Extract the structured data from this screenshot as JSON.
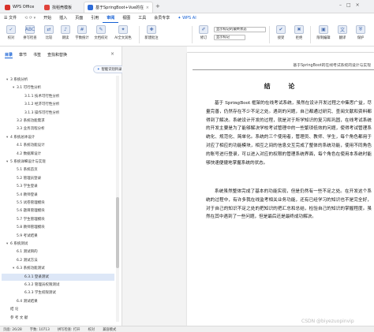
{
  "tabs": [
    {
      "label": "WPS Office",
      "color": "#d8322a"
    },
    {
      "label": "找稻壳模板",
      "color": "#e0433b"
    },
    {
      "label": "基于SpringBoot+Vue的在线考试系统",
      "color": "#2d6bd8"
    }
  ],
  "menubar": {
    "file": "☰ 文件",
    "items": [
      "开始",
      "插入",
      "页面",
      "引用",
      "审阅",
      "视图",
      "工具",
      "会员专享"
    ],
    "active": "审阅",
    "ai": "WPS AI"
  },
  "ribbon": {
    "buttons": [
      "校对",
      "拼写检查",
      "比较",
      "朗读",
      "字数统计",
      "文档校对",
      "AI全文润色",
      "新建批注"
    ],
    "right_buttons": [
      "修订",
      "显示标记",
      "审阅",
      "接受",
      "拒绝",
      "限制编辑",
      "翻译",
      "保护"
    ],
    "markup_select": "显示标记的最终状态",
    "markup_select2": "显示标记"
  },
  "nav": {
    "tabs": [
      "目录",
      "章节",
      "书签",
      "查找和替换"
    ],
    "ai_button": "智能识别目录",
    "items": [
      {
        "label": "3 系统分析",
        "level": 1,
        "caret": "▾"
      },
      {
        "label": "3.1 可行性分析",
        "level": 2,
        "caret": "▾"
      },
      {
        "label": "3.1.1 技术可行性分析",
        "level": 3,
        "caret": ""
      },
      {
        "label": "3.1.2 经济可行性分析",
        "level": 3,
        "caret": ""
      },
      {
        "label": "3.1.3 操作可行性分析",
        "level": 3,
        "caret": ""
      },
      {
        "label": "3.2 系统功能需求",
        "level": 2,
        "caret": ""
      },
      {
        "label": "3.3 业务流程分析",
        "level": 2,
        "caret": ""
      },
      {
        "label": "4 系统总体设计",
        "level": 1,
        "caret": "▾"
      },
      {
        "label": "4.1 系统功能设计",
        "level": 2,
        "caret": ""
      },
      {
        "label": "4.2 数据库设计",
        "level": 2,
        "caret": ""
      },
      {
        "label": "5 系统详细设计与实现",
        "level": 1,
        "caret": "▾"
      },
      {
        "label": "5.1 系统首页",
        "level": 2,
        "caret": ""
      },
      {
        "label": "5.2 管理员登录",
        "level": 2,
        "caret": ""
      },
      {
        "label": "5.3 学生登录",
        "level": 2,
        "caret": ""
      },
      {
        "label": "5.4 教师登录",
        "level": 2,
        "caret": ""
      },
      {
        "label": "5.5 试卷管理模块",
        "level": 2,
        "caret": ""
      },
      {
        "label": "5.6 题目管理模块",
        "level": 2,
        "caret": ""
      },
      {
        "label": "5.7 学生管理模块",
        "level": 2,
        "caret": ""
      },
      {
        "label": "5.8 教师管理模块",
        "level": 2,
        "caret": ""
      },
      {
        "label": "5.9 考试结果",
        "level": 2,
        "caret": ""
      },
      {
        "label": "6 系统测试",
        "level": 1,
        "caret": "▾"
      },
      {
        "label": "6.1 测试目的",
        "level": 2,
        "caret": ""
      },
      {
        "label": "6.2 测试方法",
        "level": 2,
        "caret": ""
      },
      {
        "label": "6.3 系统功能测试",
        "level": 2,
        "caret": "▾"
      },
      {
        "label": "6.3.1 登录测试",
        "level": 3,
        "caret": "",
        "selected": true
      },
      {
        "label": "6.3.2 管理员权限测试",
        "level": 3,
        "caret": ""
      },
      {
        "label": "6.3.3 学生权限测试",
        "level": 3,
        "caret": ""
      },
      {
        "label": "6.4 测试结果",
        "level": 2,
        "caret": ""
      },
      {
        "label": "结 论",
        "level": 1,
        "caret": ""
      },
      {
        "label": "参 考 文 献",
        "level": 1,
        "caret": ""
      }
    ]
  },
  "document": {
    "header": "基于SpringBoot的在线考试系统的设计与实现",
    "title": "结 论",
    "paragraphs": [
      "基于 SpringBoot 框架的在线考试系统，虽然在设计开发过程之中集思广益，尽量完善，仍然存在不少不足之处。遇到的问题，自己都通过研究、查阅文献和资料都得到了解决。系统设计开发的过程，就是对于所学知识的复习和巩固，在线考试系统的开发主要是为了能够解决学校考试管理中的一些繁琐低效的问题，使得考试管理系统化、规范化、简单化。系统的三个使用者，管理员、教师、学生，每个角色都用于对应了相应的功能模块，相互之间的信息交互完成了整体的系统功能，使用不同角色的账号进行登录，可以进入对应的权限的管理系统界面，每个角色在使用本系统时能够快速便捷地掌握系统的状态。",
      "系统虽然整体完成了基本的功能实现，但是仍然有一些不足之处。在开发这个系统的过程中，有许多我在线监考相关业务功能，还有已经学习的知识也不是完全好，对于自己的知识不足之处的把知识的把汇总和总结，检验自己的知识的掌握程度。虽然在其中遇到了一些问题，但是最后还是最终成功解决。"
    ]
  },
  "status": {
    "page": "页面: 26/28",
    "words": "字数: 10713",
    "spell": "拼写检查: 打开",
    "proof": "校对",
    "compat": "兼容模式"
  },
  "watermark": "CSDN @biyezuopinvip",
  "colors": {
    "accent": "#1560d4",
    "selected_row": "#dde7f7"
  }
}
